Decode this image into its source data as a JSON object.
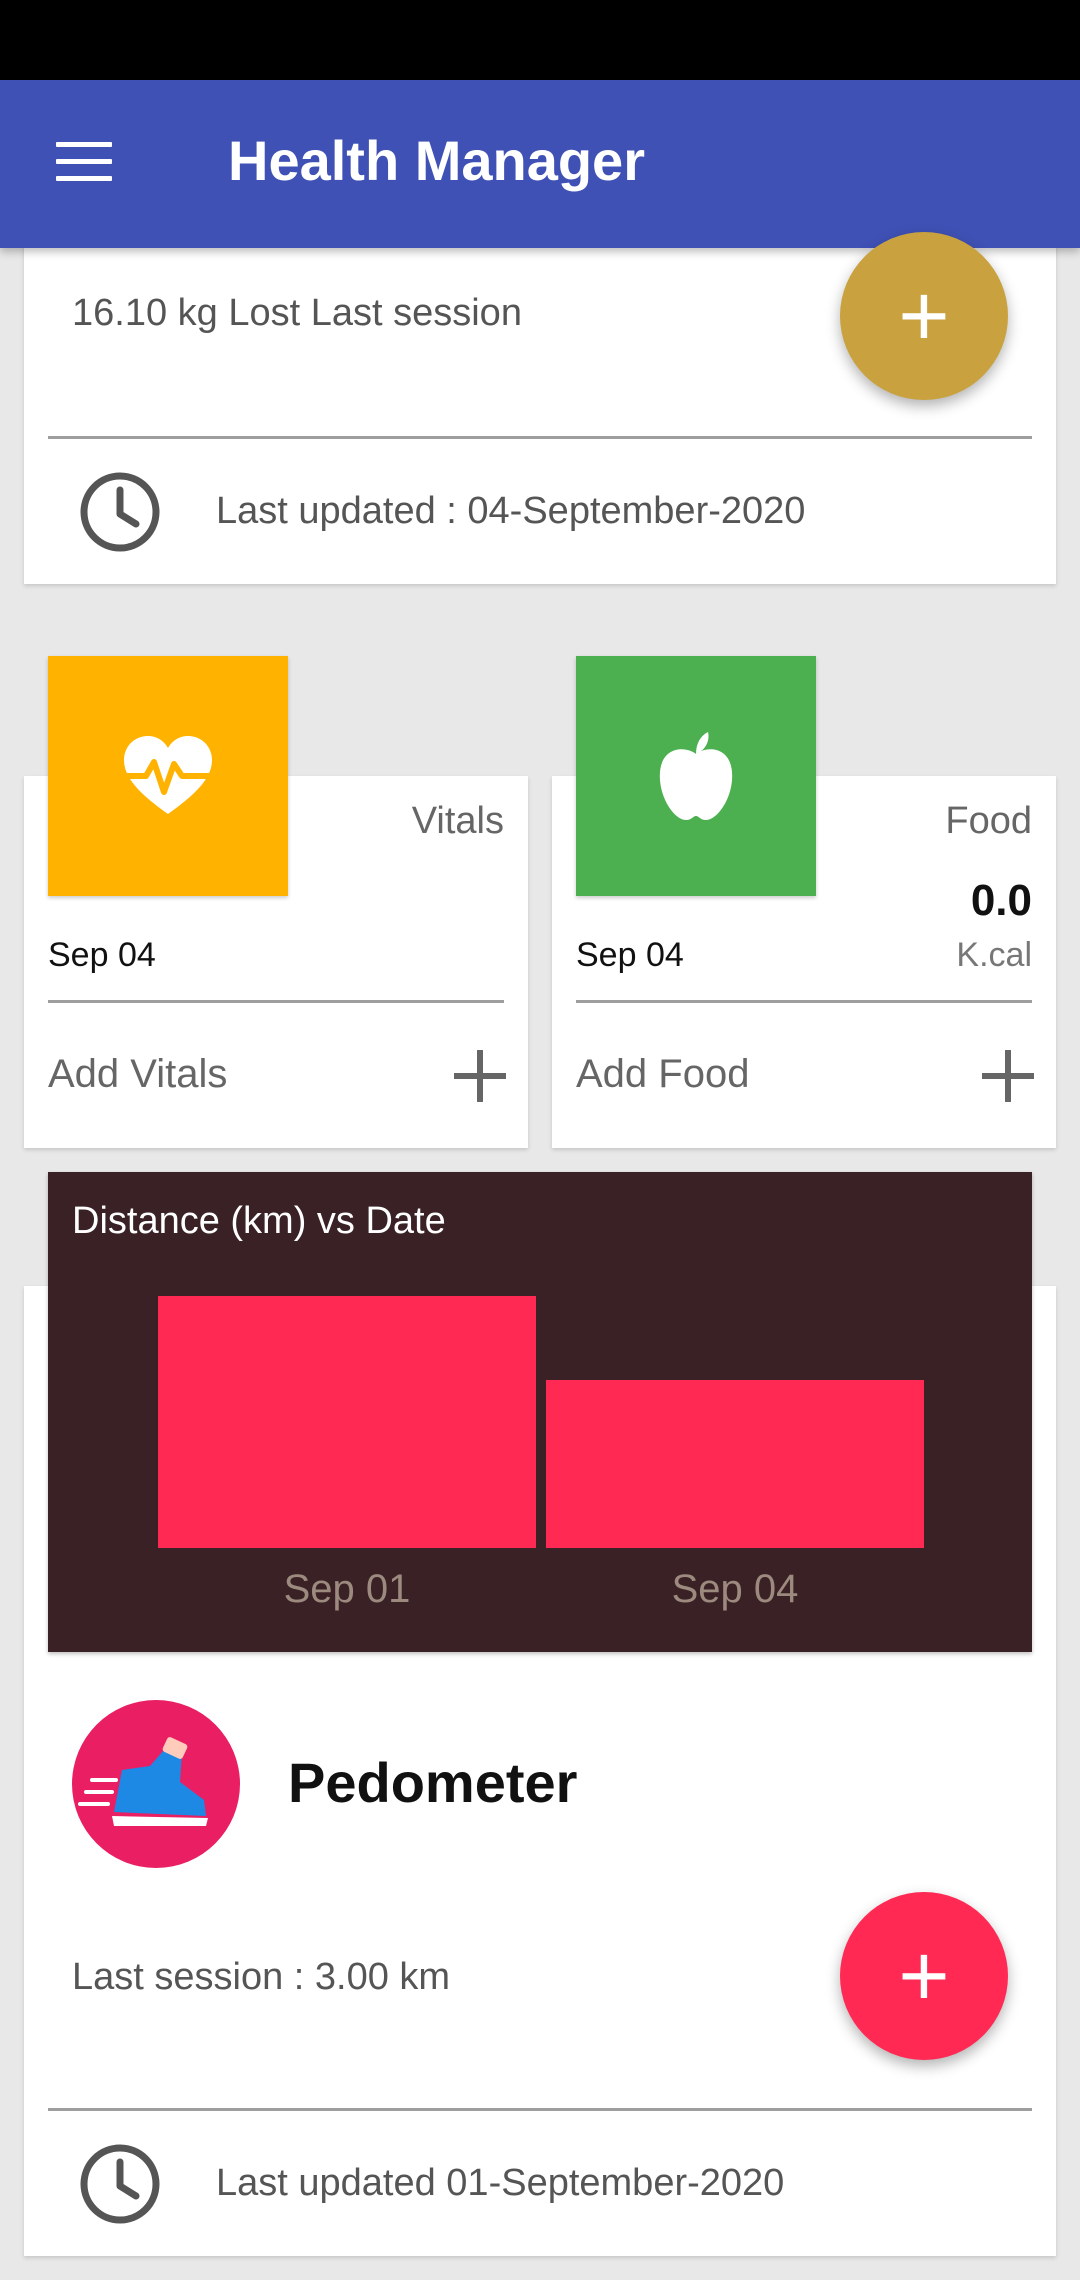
{
  "app": {
    "title": "Health Manager"
  },
  "weight": {
    "lost_text": "16.10 kg Lost Last session",
    "updated_text": "Last updated : 04-September-2020",
    "fab_color": "#c9a13e"
  },
  "vitals": {
    "title": "Vitals",
    "date": "Sep 04",
    "add_label": "Add Vitals",
    "tile_color": "#ffb300"
  },
  "food": {
    "title": "Food",
    "value": "0.0",
    "unit": "K.cal",
    "date": "Sep 04",
    "add_label": "Add Food",
    "tile_color": "#4caf50"
  },
  "chart_data": {
    "type": "bar",
    "title": "Distance (km) vs Date",
    "categories": [
      "Sep 01",
      "Sep 04"
    ],
    "values": [
      3.0,
      2.0
    ],
    "bar_color": "#ff2954",
    "background": "#3a2126",
    "grid": false
  },
  "pedometer": {
    "title": "Pedometer",
    "last_session": "Last session : 3.00 km",
    "updated_text": "Last updated 01-September-2020",
    "fab_color": "#ff2954"
  },
  "icons": {
    "menu": "menu-icon",
    "clock": "clock-icon",
    "heart": "heartbeat-icon",
    "apple": "apple-icon",
    "plus": "plus-icon",
    "shoe": "running-shoe-icon"
  }
}
